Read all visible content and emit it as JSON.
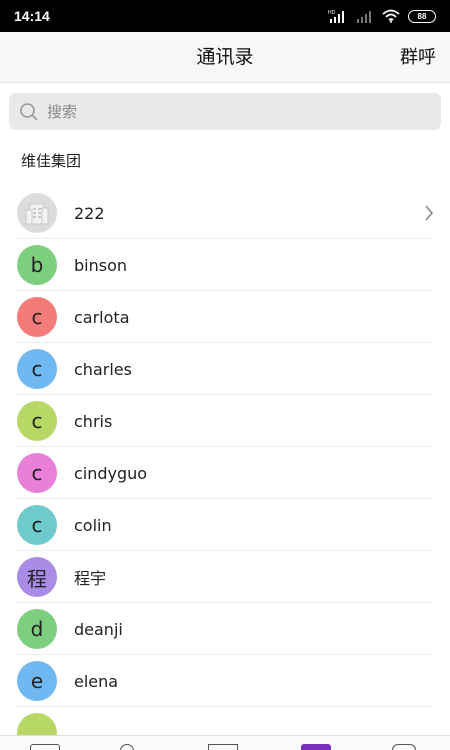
{
  "status_bar": {
    "time": "14:14",
    "network": "HD",
    "battery": "88"
  },
  "header": {
    "title": "通讯录",
    "action": "群呼"
  },
  "search": {
    "placeholder": "搜索"
  },
  "group": {
    "title": "维佳集团"
  },
  "contacts": [
    {
      "avatar_text": "",
      "name": "222",
      "color": "#d9d9d9",
      "has_chevron": true,
      "icon": "building-icon"
    },
    {
      "avatar_text": "b",
      "name": "binson",
      "color": "#7ccf7c"
    },
    {
      "avatar_text": "c",
      "name": "carlota",
      "color": "#f57b7b"
    },
    {
      "avatar_text": "c",
      "name": "charles",
      "color": "#6fb8f2"
    },
    {
      "avatar_text": "c",
      "name": "chris",
      "color": "#b7d864"
    },
    {
      "avatar_text": "c",
      "name": "cindyguo",
      "color": "#e880d8"
    },
    {
      "avatar_text": "c",
      "name": "colin",
      "color": "#6fcacb"
    },
    {
      "avatar_text": "程",
      "name": "程宇",
      "color": "#a98ce6"
    },
    {
      "avatar_text": "d",
      "name": "deanji",
      "color": "#7ccf7c"
    },
    {
      "avatar_text": "e",
      "name": "elena",
      "color": "#6fb8f2"
    },
    {
      "avatar_text": "",
      "name": "",
      "color": "#b7d864"
    }
  ],
  "tabbar": {
    "items": [
      {
        "icon": "message-icon"
      },
      {
        "icon": "contacts-icon"
      },
      {
        "icon": "calendar-icon"
      },
      {
        "icon": "app-icon",
        "active": true,
        "color": "#7b2fbf"
      },
      {
        "icon": "settings-icon"
      }
    ]
  }
}
